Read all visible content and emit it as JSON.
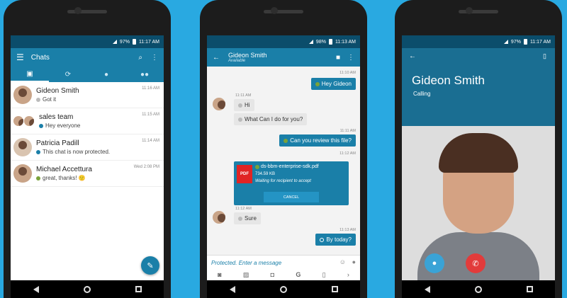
{
  "status": {
    "phone1": {
      "battery": "97%",
      "time": "11:17 AM"
    },
    "phone2": {
      "battery": "98%",
      "time": "11:13 AM"
    },
    "phone3": {
      "battery": "97%",
      "time": "11:17 AM"
    }
  },
  "chats_screen": {
    "title": "Chats",
    "items": [
      {
        "name": "Gideon Smith",
        "message": "Got it",
        "time": "11:16 AM"
      },
      {
        "name": "sales team",
        "message": "Hey everyone",
        "time": "11:15 AM"
      },
      {
        "name": "Patricia Padill",
        "message": "This chat is now protected.",
        "time": "11:14 AM"
      },
      {
        "name": "Michael Accettura",
        "message": "great, thanks! 🙂",
        "time": "Wed 2:08 PM"
      }
    ]
  },
  "conversation": {
    "contact_name": "Gideon Smith",
    "contact_status": "Available",
    "messages": [
      {
        "time": "11:10 AM",
        "text": "Hey Gideon"
      },
      {
        "time": "11:11 AM",
        "text": "Hi"
      },
      {
        "time": "",
        "text": "What Can I do for you?"
      },
      {
        "time": "11:11 AM",
        "text": "Can you review this file?"
      },
      {
        "time": "11:12 AM",
        "text": ""
      },
      {
        "time": "11:12 AM",
        "text": "Sure"
      },
      {
        "time": "11:13 AM",
        "text": "By today?"
      }
    ],
    "file": {
      "badge": "PDF",
      "name": "ds-bbm-enterprise-sdk.pdf",
      "size": "734.59 KB",
      "status": "Waiting for recipient to accept",
      "cancel_label": "CANCEL"
    },
    "composer_placeholder": "Protected. Enter a message"
  },
  "call_screen": {
    "name": "Gideon Smith",
    "status": "Calling"
  }
}
